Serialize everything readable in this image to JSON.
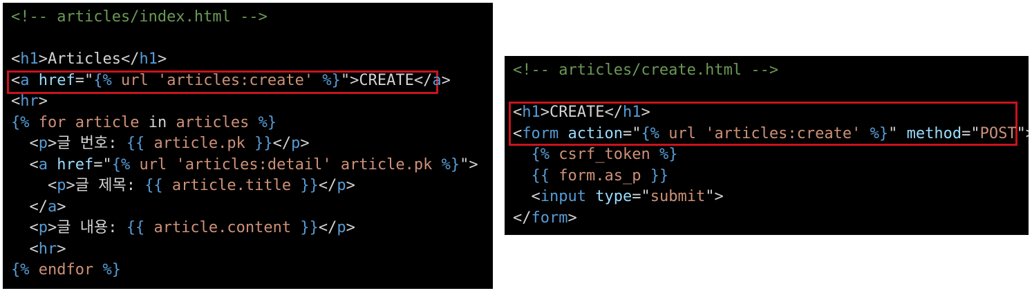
{
  "colors": {
    "background": "#000000",
    "default": "#d4d4d4",
    "comment": "#6a9955",
    "tag": "#569cd6",
    "attr": "#9cdcfe",
    "string": "#ce9178",
    "template": "#569cd6",
    "keyword": "#c586c0",
    "highlight_border": "#c8141e"
  },
  "left_editor": {
    "lines": [
      [
        {
          "t": "<!-- articles/index.html -->",
          "c": "comment"
        }
      ],
      [],
      [
        {
          "t": "<",
          "c": "default"
        },
        {
          "t": "h1",
          "c": "tag"
        },
        {
          "t": ">Articles</",
          "c": "default"
        },
        {
          "t": "h1",
          "c": "tag"
        },
        {
          "t": ">",
          "c": "default"
        }
      ],
      [
        {
          "t": "<",
          "c": "default"
        },
        {
          "t": "a",
          "c": "tag"
        },
        {
          "t": " ",
          "c": "default"
        },
        {
          "t": "href",
          "c": "attr"
        },
        {
          "t": "=\"",
          "c": "default"
        },
        {
          "t": "{%",
          "c": "template"
        },
        {
          "t": " url ",
          "c": "string"
        },
        {
          "t": "'articles:create'",
          "c": "string"
        },
        {
          "t": " ",
          "c": "string"
        },
        {
          "t": "%}",
          "c": "template"
        },
        {
          "t": "\">CREATE</",
          "c": "default"
        },
        {
          "t": "a",
          "c": "tag"
        },
        {
          "t": ">",
          "c": "default"
        }
      ],
      [
        {
          "t": "<",
          "c": "default"
        },
        {
          "t": "hr",
          "c": "tag"
        },
        {
          "t": ">",
          "c": "default"
        }
      ],
      [
        {
          "t": "{%",
          "c": "template"
        },
        {
          "t": " for ",
          "c": "string"
        },
        {
          "t": "article",
          "c": "string"
        },
        {
          "t": " in ",
          "c": "default"
        },
        {
          "t": "articles",
          "c": "string"
        },
        {
          "t": " ",
          "c": "default"
        },
        {
          "t": "%}",
          "c": "template"
        }
      ],
      [
        {
          "t": "  <",
          "c": "default"
        },
        {
          "t": "p",
          "c": "tag"
        },
        {
          "t": ">글 번호: ",
          "c": "default"
        },
        {
          "t": "{{",
          "c": "template"
        },
        {
          "t": " article.pk ",
          "c": "string"
        },
        {
          "t": "}}",
          "c": "template"
        },
        {
          "t": "</",
          "c": "default"
        },
        {
          "t": "p",
          "c": "tag"
        },
        {
          "t": ">",
          "c": "default"
        }
      ],
      [
        {
          "t": "  <",
          "c": "default"
        },
        {
          "t": "a",
          "c": "tag"
        },
        {
          "t": " ",
          "c": "default"
        },
        {
          "t": "href",
          "c": "attr"
        },
        {
          "t": "=\"",
          "c": "default"
        },
        {
          "t": "{%",
          "c": "template"
        },
        {
          "t": " url 'articles:detail' article.pk ",
          "c": "string"
        },
        {
          "t": "%}",
          "c": "template"
        },
        {
          "t": "\">",
          "c": "default"
        }
      ],
      [
        {
          "t": "    <",
          "c": "default"
        },
        {
          "t": "p",
          "c": "tag"
        },
        {
          "t": ">글 제목: ",
          "c": "default"
        },
        {
          "t": "{{",
          "c": "template"
        },
        {
          "t": " article.title ",
          "c": "string"
        },
        {
          "t": "}}",
          "c": "template"
        },
        {
          "t": "</",
          "c": "default"
        },
        {
          "t": "p",
          "c": "tag"
        },
        {
          "t": ">",
          "c": "default"
        }
      ],
      [
        {
          "t": "  </",
          "c": "default"
        },
        {
          "t": "a",
          "c": "tag"
        },
        {
          "t": ">",
          "c": "default"
        }
      ],
      [
        {
          "t": "  <",
          "c": "default"
        },
        {
          "t": "p",
          "c": "tag"
        },
        {
          "t": ">글 내용: ",
          "c": "default"
        },
        {
          "t": "{{",
          "c": "template"
        },
        {
          "t": " article.content ",
          "c": "string"
        },
        {
          "t": "}}",
          "c": "template"
        },
        {
          "t": "</",
          "c": "default"
        },
        {
          "t": "p",
          "c": "tag"
        },
        {
          "t": ">",
          "c": "default"
        }
      ],
      [
        {
          "t": "  <",
          "c": "default"
        },
        {
          "t": "hr",
          "c": "tag"
        },
        {
          "t": ">",
          "c": "default"
        }
      ],
      [
        {
          "t": "{%",
          "c": "template"
        },
        {
          "t": " endfor ",
          "c": "string"
        },
        {
          "t": "%}",
          "c": "template"
        }
      ]
    ]
  },
  "right_editor": {
    "lines": [
      [
        {
          "t": "<!-- articles/create.html -->",
          "c": "comment"
        }
      ],
      [],
      [
        {
          "t": "<",
          "c": "default"
        },
        {
          "t": "h1",
          "c": "tag"
        },
        {
          "t": ">CREATE</",
          "c": "default"
        },
        {
          "t": "h1",
          "c": "tag"
        },
        {
          "t": ">",
          "c": "default"
        }
      ],
      [
        {
          "t": "<",
          "c": "default"
        },
        {
          "t": "form",
          "c": "tag"
        },
        {
          "t": " ",
          "c": "default"
        },
        {
          "t": "action",
          "c": "attr"
        },
        {
          "t": "=\"",
          "c": "default"
        },
        {
          "t": "{%",
          "c": "template"
        },
        {
          "t": " url 'articles:create' ",
          "c": "string"
        },
        {
          "t": "%}",
          "c": "template"
        },
        {
          "t": "\" ",
          "c": "default"
        },
        {
          "t": "method",
          "c": "attr"
        },
        {
          "t": "=\"",
          "c": "default"
        },
        {
          "t": "POST",
          "c": "string"
        },
        {
          "t": "\">",
          "c": "default"
        }
      ],
      [
        {
          "t": "  ",
          "c": "default"
        },
        {
          "t": "{%",
          "c": "template"
        },
        {
          "t": " csrf_token ",
          "c": "string"
        },
        {
          "t": "%}",
          "c": "template"
        }
      ],
      [
        {
          "t": "  ",
          "c": "default"
        },
        {
          "t": "{{",
          "c": "template"
        },
        {
          "t": " form.as_p ",
          "c": "string"
        },
        {
          "t": "}}",
          "c": "template"
        }
      ],
      [
        {
          "t": "  <",
          "c": "default"
        },
        {
          "t": "input",
          "c": "tag"
        },
        {
          "t": " ",
          "c": "default"
        },
        {
          "t": "type",
          "c": "attr"
        },
        {
          "t": "=\"",
          "c": "default"
        },
        {
          "t": "submit",
          "c": "string"
        },
        {
          "t": "\">",
          "c": "default"
        }
      ],
      [
        {
          "t": "</",
          "c": "default"
        },
        {
          "t": "form",
          "c": "tag"
        },
        {
          "t": ">",
          "c": "default"
        }
      ]
    ]
  }
}
